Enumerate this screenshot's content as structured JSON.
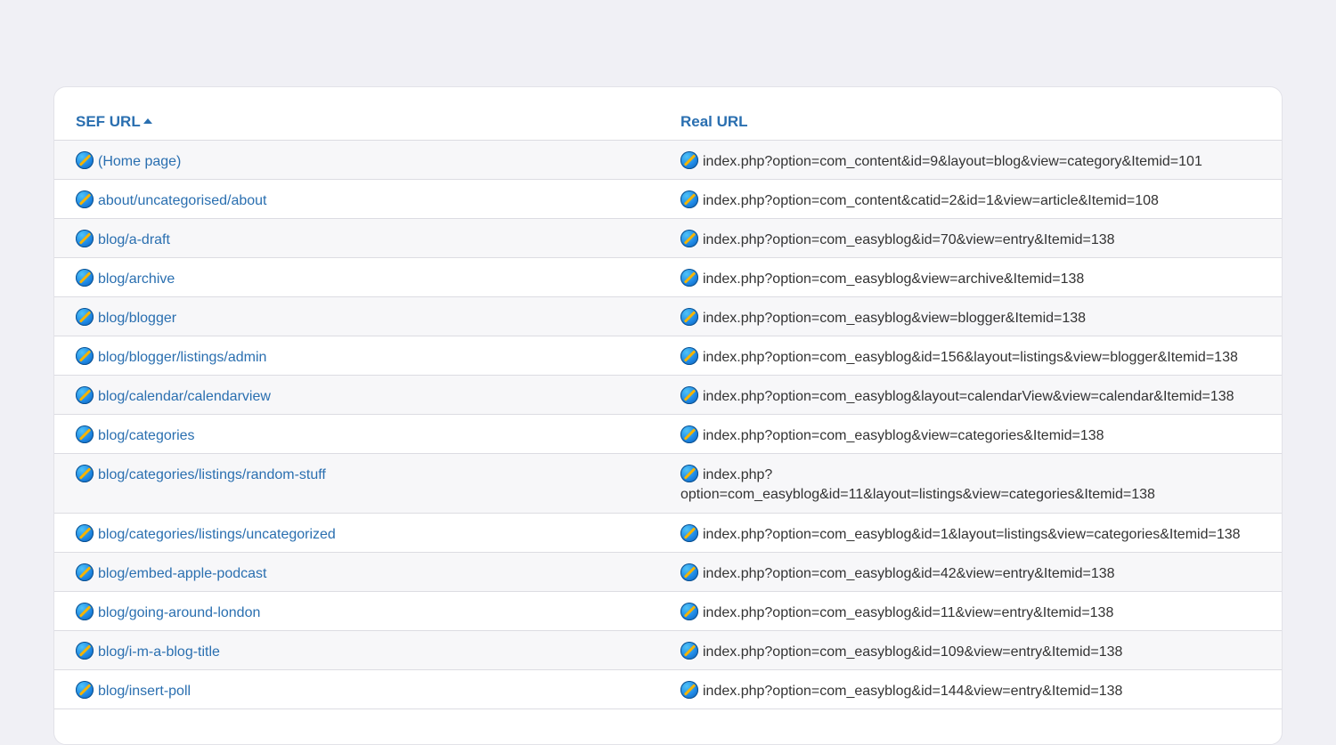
{
  "table": {
    "headers": {
      "sef_url": "SEF URL",
      "real_url": "Real URL"
    },
    "sort": {
      "column": "sef_url",
      "direction": "ascending",
      "icon": "caret-up-icon"
    },
    "row_icon": "edit-icon",
    "rows": [
      {
        "sef": "(Home page)",
        "real": "index.php?option=com_content&id=9&layout=blog&view=category&Itemid=101"
      },
      {
        "sef": "about/uncategorised/about",
        "real": "index.php?option=com_content&catid=2&id=1&view=article&Itemid=108"
      },
      {
        "sef": "blog/a-draft",
        "real": "index.php?option=com_easyblog&id=70&view=entry&Itemid=138"
      },
      {
        "sef": "blog/archive",
        "real": "index.php?option=com_easyblog&view=archive&Itemid=138"
      },
      {
        "sef": "blog/blogger",
        "real": "index.php?option=com_easyblog&view=blogger&Itemid=138"
      },
      {
        "sef": "blog/blogger/listings/admin",
        "real": "index.php?option=com_easyblog&id=156&layout=listings&view=blogger&Itemid=138"
      },
      {
        "sef": "blog/calendar/calendarview",
        "real": "index.php?option=com_easyblog&layout=calendarView&view=calendar&Itemid=138"
      },
      {
        "sef": "blog/categories",
        "real": "index.php?option=com_easyblog&view=categories&Itemid=138"
      },
      {
        "sef": "blog/categories/listings/random-stuff",
        "real": "index.php?option=com_easyblog&id=11&layout=listings&view=categories&Itemid=138"
      },
      {
        "sef": "blog/categories/listings/uncategorized",
        "real": "index.php?option=com_easyblog&id=1&layout=listings&view=categories&Itemid=138"
      },
      {
        "sef": "blog/embed-apple-podcast",
        "real": "index.php?option=com_easyblog&id=42&view=entry&Itemid=138"
      },
      {
        "sef": "blog/going-around-london",
        "real": "index.php?option=com_easyblog&id=11&view=entry&Itemid=138"
      },
      {
        "sef": "blog/i-m-a-blog-title",
        "real": "index.php?option=com_easyblog&id=109&view=entry&Itemid=138"
      },
      {
        "sef": "blog/insert-poll",
        "real": "index.php?option=com_easyblog&id=144&view=entry&Itemid=138"
      }
    ]
  },
  "colors": {
    "link": "#2a6fb0",
    "text": "#333333",
    "page_bg": "#f0f0f5",
    "row_alt": "#f7f7f9"
  }
}
